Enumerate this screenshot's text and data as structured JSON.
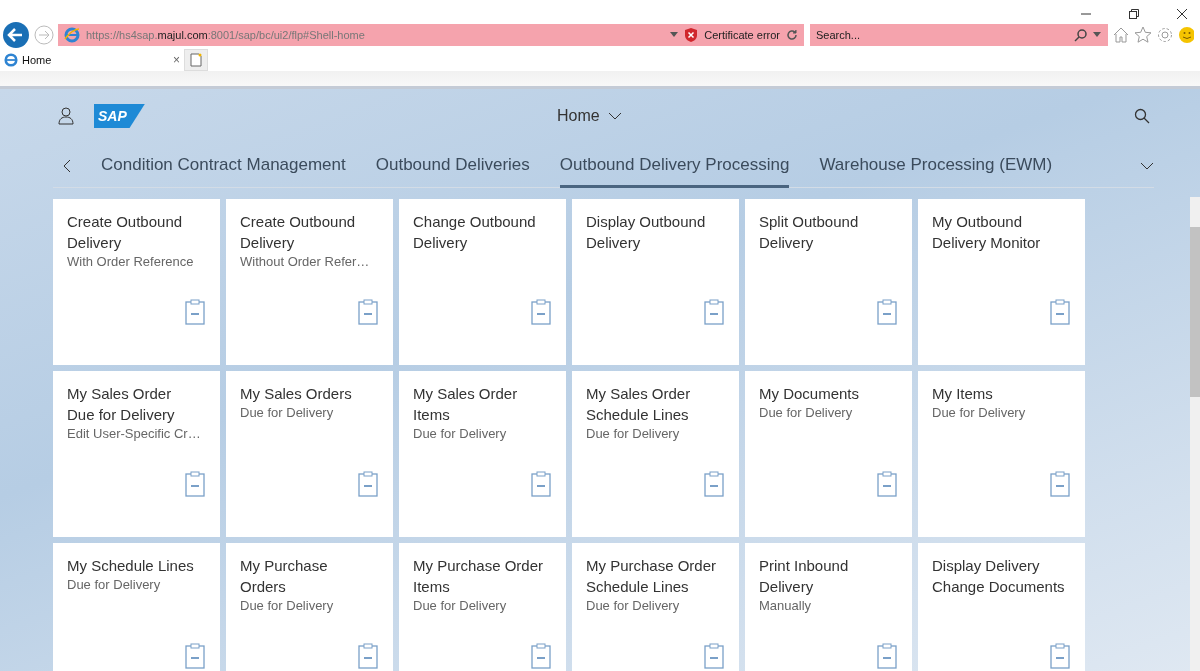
{
  "browser": {
    "url_prefix": "https://hs4sap.",
    "url_domain": "majul.com",
    "url_suffix": ":8001/sap/bc/ui2/flp#Shell-home",
    "certificate": "Certificate error",
    "search": {
      "placeholder": "Search..."
    },
    "tab": {
      "label": "Home",
      "close": "×"
    }
  },
  "shell": {
    "logo": "SAP",
    "title": "Home",
    "tabs": [
      {
        "label": "Condition Contract Management",
        "selected": false
      },
      {
        "label": "Outbound Deliveries",
        "selected": false
      },
      {
        "label": "Outbound Delivery Processing",
        "selected": true
      },
      {
        "label": "Warehouse Processing (EWM)",
        "selected": false
      }
    ],
    "tiles": [
      {
        "title": "Create Outbound Delivery",
        "subtitle": "With Order Reference"
      },
      {
        "title": "Create Outbound Delivery",
        "subtitle": "Without Order Refer…"
      },
      {
        "title": "Change Outbound Delivery"
      },
      {
        "title": "Display Outbound Delivery"
      },
      {
        "title": "Split Outbound Delivery"
      },
      {
        "title": "My Outbound Delivery Monitor"
      },
      {
        "title": "My Sales Order Due for Delivery",
        "subtitle": "Edit User-Specific Cr…"
      },
      {
        "title": "My Sales Orders",
        "subtitle": "Due for Delivery"
      },
      {
        "title": "My Sales Order Items",
        "subtitle": "Due for Delivery"
      },
      {
        "title": "My Sales Order Schedule Lines",
        "subtitle": "Due for Delivery"
      },
      {
        "title": "My Documents",
        "subtitle": "Due for Delivery"
      },
      {
        "title": "My Items",
        "subtitle": "Due for Delivery"
      },
      {
        "title": "My Schedule Lines",
        "subtitle": "Due for Delivery"
      },
      {
        "title": "My Purchase Orders",
        "subtitle": "Due for Delivery"
      },
      {
        "title": "My Purchase Order Items",
        "subtitle": "Due for Delivery"
      },
      {
        "title": "My Purchase Order Schedule Lines",
        "subtitle": "Due for Delivery"
      },
      {
        "title": "Print Inbound Delivery",
        "subtitle": "Manually"
      },
      {
        "title": "Display Delivery Change Documents"
      }
    ]
  }
}
